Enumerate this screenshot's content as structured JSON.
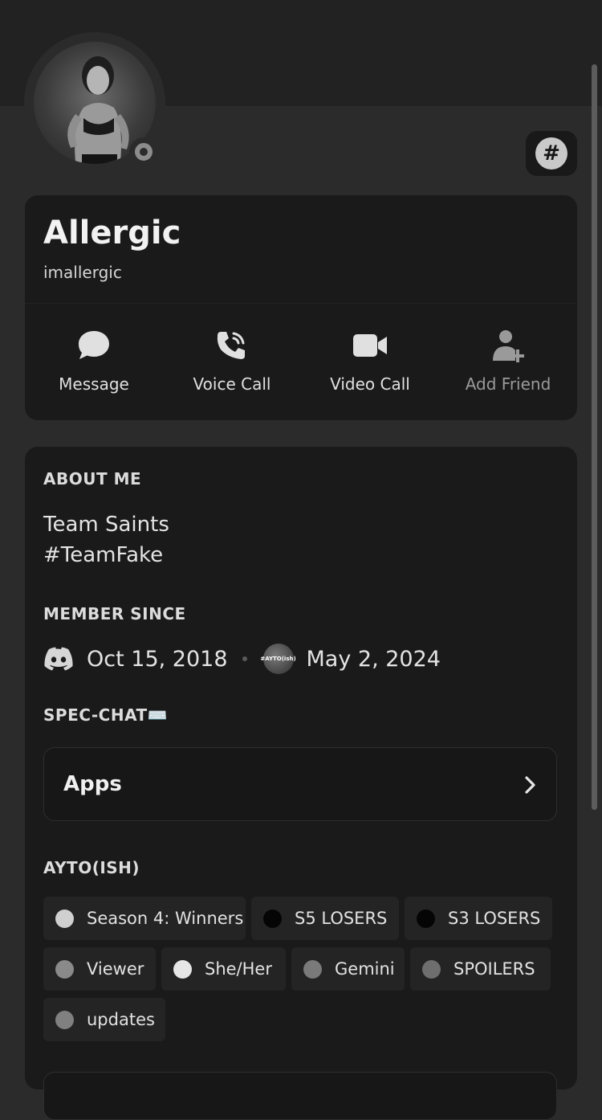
{
  "profile": {
    "display_name": "Allergic",
    "username": "imallergic",
    "status": "offline",
    "badge_icon": "hashtag-icon"
  },
  "actions": [
    {
      "label": "Message",
      "icon": "chat-bubble-icon",
      "enabled": true
    },
    {
      "label": "Voice Call",
      "icon": "phone-icon",
      "enabled": true
    },
    {
      "label": "Video Call",
      "icon": "video-camera-icon",
      "enabled": true
    },
    {
      "label": "Add Friend",
      "icon": "add-friend-icon",
      "enabled": false
    }
  ],
  "about": {
    "heading": "ABOUT ME",
    "lines": [
      "Team Saints",
      "#TeamFake"
    ]
  },
  "member_since": {
    "heading": "MEMBER SINCE",
    "discord_date": "Oct 15, 2018",
    "server_date": "May 2, 2024",
    "server_icon_text": "#AYTO(ish)"
  },
  "spec_chat": {
    "heading": "SPEC-CHAT⌨️",
    "apps_label": "Apps"
  },
  "ayto": {
    "heading": "AYTO(ISH)",
    "roles": [
      {
        "name": "Season 4: Winners",
        "color": "#d0d0d0"
      },
      {
        "name": "S5 LOSERS",
        "color": "#050505"
      },
      {
        "name": "S3 LOSERS",
        "color": "#050505"
      },
      {
        "name": "Viewer",
        "color": "#8a8a8a"
      },
      {
        "name": "She/Her",
        "color": "#e6e6e6"
      },
      {
        "name": "Gemini",
        "color": "#7a7a7a"
      },
      {
        "name": "SPOILERS",
        "color": "#6e6e6e"
      },
      {
        "name": "updates",
        "color": "#808080"
      }
    ]
  }
}
